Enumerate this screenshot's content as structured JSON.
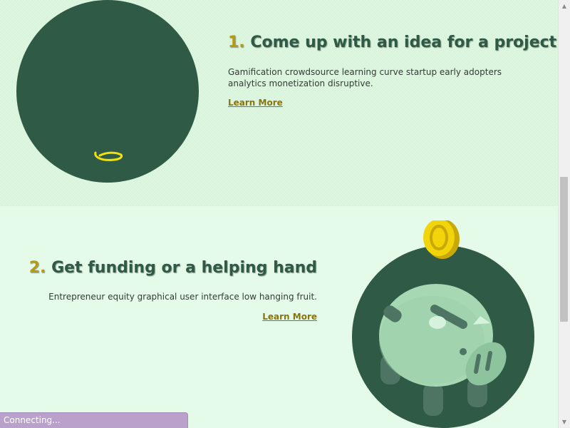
{
  "steps": [
    {
      "number": "1.",
      "title": "Come up with an idea for a project",
      "description": "Gamification crowdsource learning curve startup early adopters analytics monetization disruptive.",
      "link_label": "Learn More",
      "illustration_icon": "lightbulb-icon"
    },
    {
      "number": "2.",
      "title": "Get funding or a helping hand",
      "description": "Entrepreneur equity graphical user interface low hanging fruit.",
      "link_label": "Learn More",
      "illustration_icon": "piggy-bank-icon"
    }
  ],
  "status": {
    "text": "Connecting..."
  },
  "colors": {
    "accent": "#b59a13",
    "heading": "#2f5a45",
    "circle": "#2f5a45",
    "section_bg_1": "#d8f5dc",
    "section_bg_2": "#e2fae6",
    "coin": "#f2d40a",
    "piggy": "#a5d8b3"
  }
}
